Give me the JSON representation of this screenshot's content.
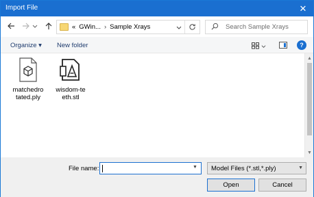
{
  "window": {
    "title": "Import File"
  },
  "nav": {
    "back_icon": "arrow-left-icon",
    "forward_icon": "arrow-right-icon",
    "recent_icon": "chevron-down-icon",
    "up_icon": "arrow-up-icon",
    "address": {
      "prefix": "«",
      "crumbs": [
        "GWin...",
        "Sample Xrays"
      ],
      "separator": "›"
    },
    "search_placeholder": "Search Sample Xrays"
  },
  "toolbar": {
    "organize_label": "Organize ▾",
    "new_folder_label": "New folder",
    "help_label": "?"
  },
  "files": [
    {
      "name_line1": "matchedro",
      "name_line2": "tated.ply",
      "icon": "3d-object-file-icon"
    },
    {
      "name_line1": "wisdom-te",
      "name_line2": "eth.stl",
      "icon": "3d-print-file-icon"
    }
  ],
  "bottom": {
    "file_name_label": "File name:",
    "file_name_value": "",
    "file_type_value": "Model Files (*.stl,*.ply)",
    "open_label": "Open",
    "cancel_label": "Cancel"
  },
  "colors": {
    "accent": "#1a6fd0",
    "title_bar": "#1a6fd0"
  }
}
